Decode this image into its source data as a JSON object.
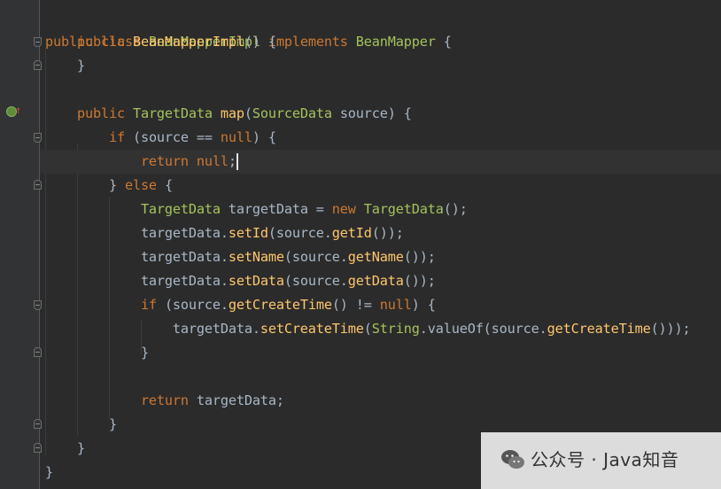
{
  "code_lines": [
    {
      "t": "public class BeanMapperImpl implements BeanMapper {"
    },
    {
      "t": "    public BeanMapperImpl() {"
    },
    {
      "t": "    }"
    },
    {
      "t": ""
    },
    {
      "t": "    public TargetData map(SourceData source) {"
    },
    {
      "t": "        if (source == null) {"
    },
    {
      "t": "            return null;"
    },
    {
      "t": "        } else {"
    },
    {
      "t": "            TargetData targetData = new TargetData();"
    },
    {
      "t": "            targetData.setId(source.getId());"
    },
    {
      "t": "            targetData.setName(source.getName());"
    },
    {
      "t": "            targetData.setData(source.getData());"
    },
    {
      "t": "            if (source.getCreateTime() != null) {"
    },
    {
      "t": "                targetData.setCreateTime(String.valueOf(source.getCreateTime()));"
    },
    {
      "t": "            }"
    },
    {
      "t": ""
    },
    {
      "t": "            return targetData;"
    },
    {
      "t": "        }"
    },
    {
      "t": "    }"
    },
    {
      "t": "}"
    }
  ],
  "current_line_index": 6,
  "gutter": {
    "override_marker_icon": "implements-method-icon"
  },
  "watermark": {
    "icon": "wechat-icon",
    "text": "公众号 · Java知音"
  }
}
